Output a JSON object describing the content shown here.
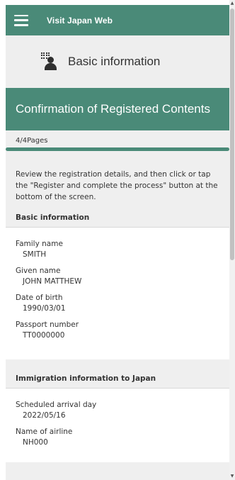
{
  "header": {
    "app_title": "Visit Japan Web"
  },
  "section": {
    "title": "Basic information"
  },
  "banner": {
    "title": "Confirmation of Registered Contents"
  },
  "progress": {
    "page_indicator": "4/4Pages",
    "fraction": 1.0
  },
  "instructions": "Review the registration details, and then click or tap the \"Register and complete the process\" button at the bottom of the screen.",
  "basic_info": {
    "heading": "Basic information",
    "fields": [
      {
        "label": "Family name",
        "value": "SMITH"
      },
      {
        "label": "Given name",
        "value": "JOHN MATTHEW"
      },
      {
        "label": "Date of birth",
        "value": "1990/03/01"
      },
      {
        "label": "Passport number",
        "value": "TT0000000"
      }
    ]
  },
  "immigration_info": {
    "heading": "Immigration information to Japan",
    "fields": [
      {
        "label": "Scheduled arrival day",
        "value": "2022/05/16"
      },
      {
        "label": "Name of airline",
        "value": "NH000"
      }
    ]
  },
  "icons": {
    "menu": "hamburger-menu-icon",
    "section": "person-id-icon"
  },
  "colors": {
    "brand_green": "#4a8a78",
    "background": "#efefef",
    "card": "#ffffff"
  }
}
